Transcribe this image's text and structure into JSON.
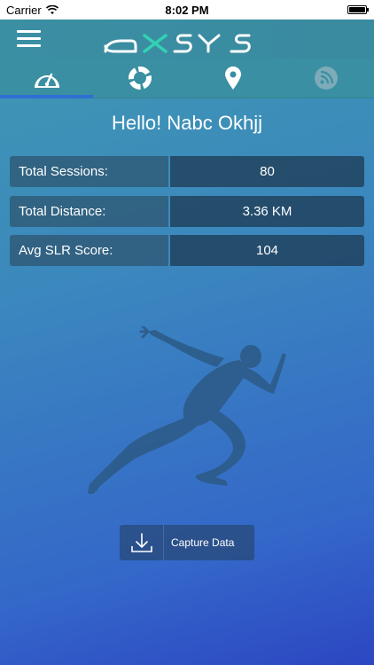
{
  "status_bar": {
    "carrier": "Carrier",
    "time": "8:02 PM",
    "icons": [
      "wifi-icon",
      "battery-icon"
    ]
  },
  "header": {
    "menu_icon": "hamburger-menu-icon",
    "logo_text": "axsys"
  },
  "tabs": [
    {
      "icon": "dashboard-gauge-icon",
      "active": true
    },
    {
      "icon": "donut-chart-icon",
      "active": false
    },
    {
      "icon": "location-pin-icon",
      "active": false
    },
    {
      "icon": "rss-feed-icon",
      "active": false
    }
  ],
  "greeting": "Hello! Nabc Okhjj",
  "stats": [
    {
      "label": "Total Sessions:",
      "value": "80"
    },
    {
      "label": "Total Distance:",
      "value": "3.36 KM"
    },
    {
      "label": "Avg SLR Score:",
      "value": "104"
    }
  ],
  "illustration": "runner-silhouette",
  "capture_button": {
    "label": "Capture Data",
    "icon": "download-icon"
  },
  "colors": {
    "header": "#3a8fa2",
    "tab_indicator": "#2f6fd3",
    "stat_label_bg": "#2c5068",
    "stat_value_bg": "#20405a"
  }
}
